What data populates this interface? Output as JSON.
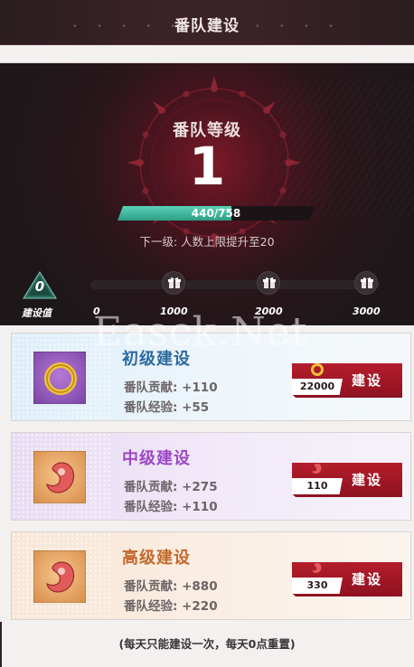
{
  "header": {
    "title": "番队建设"
  },
  "level": {
    "label": "番队等级",
    "value": "1",
    "exp_text": "440/758",
    "exp_progress": 0.58,
    "next_level_text": "下一级: 人数上限提升至20"
  },
  "construction": {
    "gem_value": "0",
    "gem_label": "建设值",
    "milestones": [
      "0",
      "1000",
      "2000",
      "3000"
    ],
    "gift_icon": "gift-icon"
  },
  "cards": [
    {
      "title": "初级建设",
      "title_color": "#2c6aa0",
      "contribution": "番队贡献: +110",
      "exp": "番队经验: +55",
      "cost": "22000",
      "cost_icon": "gold-ring-icon",
      "button_label": "建设"
    },
    {
      "title": "中级建设",
      "title_color": "#9b47c9",
      "contribution": "番队贡献: +275",
      "exp": "番队经验: +110",
      "cost": "110",
      "cost_icon": "magatama-icon",
      "button_label": "建设"
    },
    {
      "title": "高级建设",
      "title_color": "#c2692d",
      "contribution": "番队贡献: +880",
      "exp": "番队经验: +220",
      "cost": "330",
      "cost_icon": "magatama-icon",
      "button_label": "建设"
    }
  ],
  "footnote": "(每天只能建设一次，每天0点重置)",
  "watermark": "Easck.Net"
}
